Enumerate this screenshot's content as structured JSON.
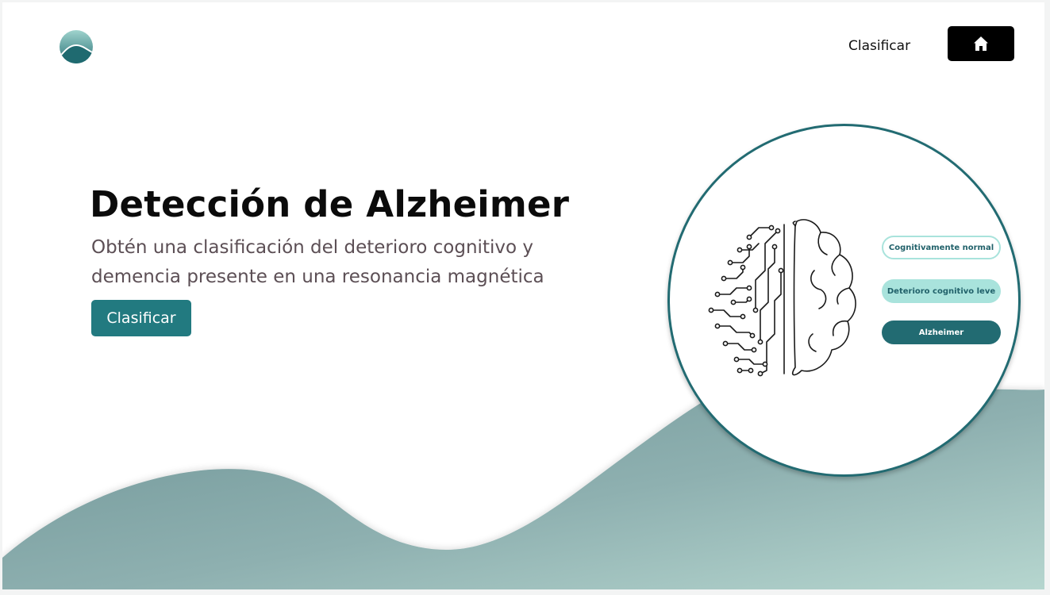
{
  "nav": {
    "link_label": "Clasificar",
    "home_icon": "home-icon",
    "logo_icon": "wave-logo-icon"
  },
  "hero": {
    "title": "Detección de Alzheimer",
    "subtitle": "Obtén una clasificación del deterioro cognitivo y demencia presente en una resonancia magnética",
    "cta_label": "Clasificar"
  },
  "illustration": {
    "brain_icon": "circuit-brain-icon",
    "classes": [
      "Cognitivamente normal",
      "Deterioro cognitivo leve",
      "Alzheimer"
    ]
  },
  "colors": {
    "accent": "#227a80",
    "dark_teal": "#226b72",
    "light_teal": "#a9e3dc",
    "wave_start": "#74989a",
    "wave_end": "#b2d3cc"
  }
}
